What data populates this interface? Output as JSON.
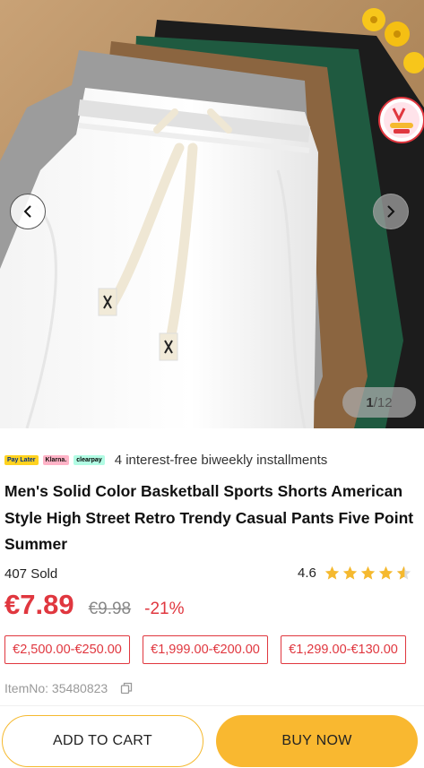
{
  "gallery": {
    "current": "1",
    "total": "/12",
    "prev_icon": "chevron-left-icon",
    "next_icon": "chevron-right-icon"
  },
  "payment": {
    "logos": [
      "Pay Later",
      "Klarna.",
      "clearpay"
    ],
    "installments_text": "4 interest-free biweekly installments"
  },
  "product": {
    "title": "Men's Solid Color Basketball Sports Shorts American Style High Street Retro Trendy Casual Pants Five Point Summer",
    "sold": "407 Sold",
    "rating": "4.6",
    "rating_value": 4.6,
    "price": "€7.89",
    "old_price": "€9.98",
    "discount": "-21%",
    "item_no": "ItemNo: 35480823"
  },
  "coupons": [
    "€2,500.00-€250.00",
    "€1,999.00-€200.00",
    "€1,299.00-€130.00"
  ],
  "actions": {
    "add_to_cart": "ADD TO CART",
    "buy_now": "BUY NOW"
  },
  "colors": {
    "accent": "#f9b830",
    "price_red": "#e0373f"
  }
}
